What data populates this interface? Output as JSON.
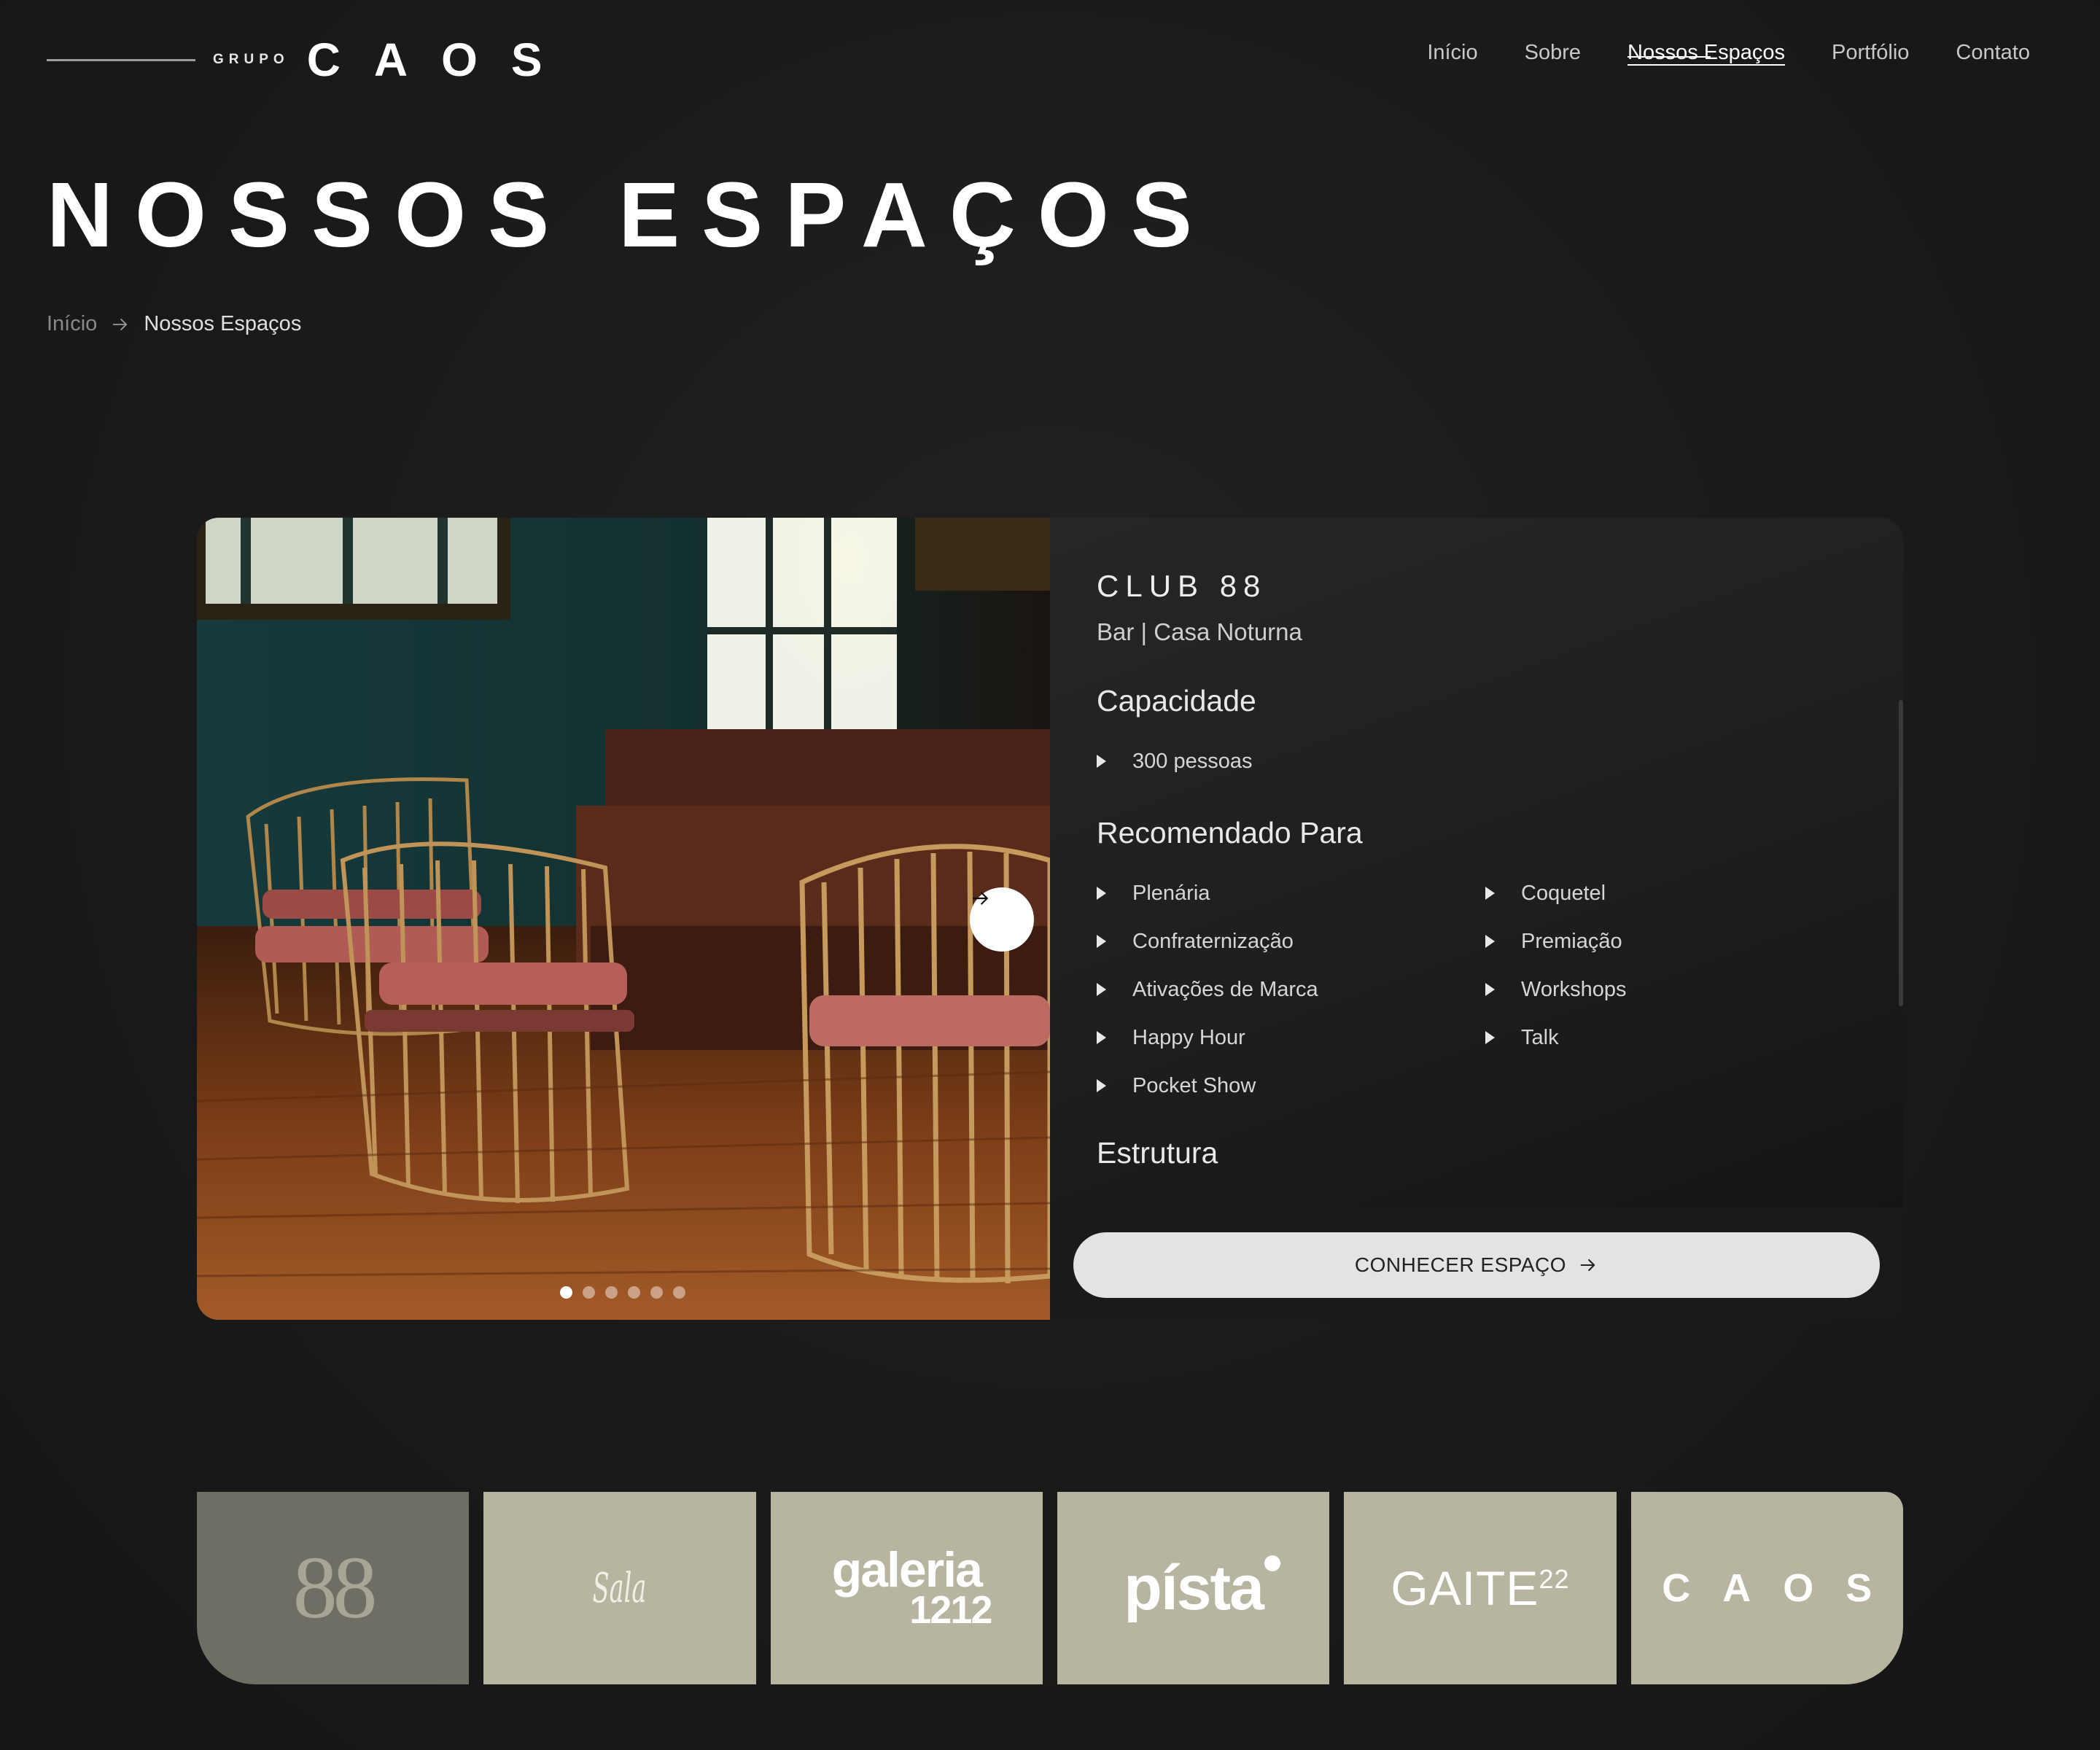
{
  "brand": {
    "grupo": "GRUPO",
    "name": "CAOS"
  },
  "nav": {
    "items": [
      {
        "label": "Início",
        "active": false
      },
      {
        "label": "Sobre",
        "active": false
      },
      {
        "label": "Nossos Espaços",
        "active": true
      },
      {
        "label": "Portfólio",
        "active": false
      },
      {
        "label": "Contato",
        "active": false
      }
    ]
  },
  "page": {
    "title": "NOSSOS ESPAÇOS"
  },
  "breadcrumb": {
    "home": "Início",
    "current": "Nossos Espaços"
  },
  "space": {
    "name": "CLUB 88",
    "type": "Bar | Casa Noturna",
    "capacity_heading": "Capacidade",
    "capacity": [
      "300 pessoas"
    ],
    "recommended_heading": "Recomendado Para",
    "recommended": [
      "Plenária",
      "Coquetel",
      "Confraternização",
      "Premiação",
      "Ativações de Marca",
      "Workshops",
      "Happy Hour",
      "Talk",
      "Pocket Show"
    ],
    "structure_heading": "Estrutura",
    "cta_label": "CONHECER ESPAÇO"
  },
  "carousel": {
    "slide_count": 6,
    "active_slide": 1
  },
  "venues": {
    "tiles": [
      {
        "label": "88",
        "active": true
      },
      {
        "label": "Sala",
        "active": false
      },
      {
        "label": "galeria",
        "label2": "1212",
        "active": false
      },
      {
        "label": "písta",
        "active": false
      },
      {
        "label": "GAITE",
        "suffix": "22",
        "active": false
      },
      {
        "label": "CAOS",
        "active": false
      }
    ]
  },
  "icons": {
    "breadcrumb_separator": "arrow-right-icon",
    "carousel_next": "arrow-right-icon",
    "cta": "arrow-right-icon",
    "bullet": "triangle-right-icon"
  },
  "colors": {
    "background": "#1b1b1b",
    "card_panel": "#202020",
    "tile": "#b7b4a0",
    "tile_active": "#6f6e65",
    "cta_button": "#e3e3e3"
  }
}
